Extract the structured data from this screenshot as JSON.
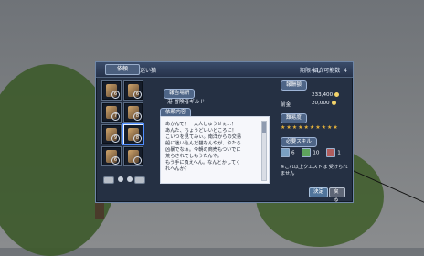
{
  "window": {
    "tab_label": "依頼",
    "title": "迷い猫",
    "status": "期限なし",
    "count_label": "紹介可能数",
    "count_value": "4"
  },
  "left_panel": {
    "slots": [
      {
        "mark": "6"
      },
      {
        "mark": "6"
      },
      {
        "mark": "7"
      },
      {
        "mark": "8"
      },
      {
        "mark": "9"
      },
      {
        "mark": "8"
      },
      {
        "mark": "6"
      },
      {
        "mark": ""
      }
    ]
  },
  "location": {
    "section_label": "報告場所",
    "text": "港 冒険者ギルド"
  },
  "request": {
    "section_label": "依頼内容",
    "text": "あかんで！　大人しゅうせぇ…！\nあんた、ちょうどいいところに！\nこいつを見てみぃ。南洋からの交易\n船に迷い込んだ猫なんやが、やたら\n凶暴でなぁ。今朝の商売もついでに\n荒らされてしもうたんや。\nもう手に負えへん。なんとかしてく\nれへんか？"
  },
  "reward": {
    "section_label": "報酬額",
    "amount": "233,400",
    "advance_label": "前金",
    "advance": "20,000",
    "difficulty_label": "難易度",
    "stars": "★★★★★★★★★★",
    "skill_label": "必要スキル",
    "skills": [
      {
        "value": "6"
      },
      {
        "value": "10"
      },
      {
        "value": "1"
      }
    ],
    "note": "※これ以上クエストは\n受けられません"
  },
  "buttons": {
    "accept": "決定",
    "back": "戻る"
  }
}
